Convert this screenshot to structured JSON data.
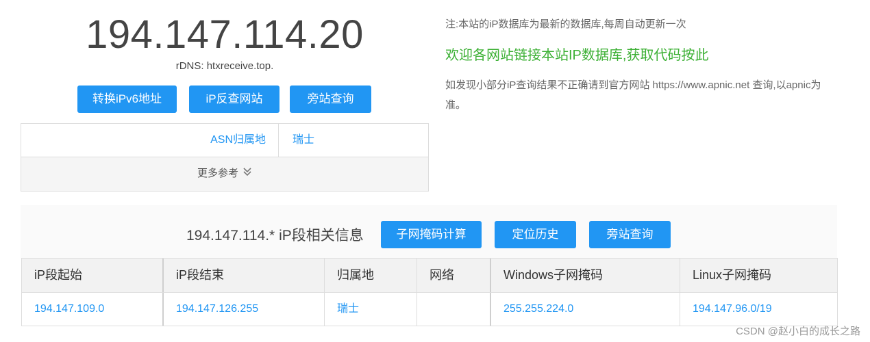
{
  "ip": {
    "address": "194.147.114.20",
    "rdns": "rDNS: htxreceive.top."
  },
  "actions": {
    "ipv6": "转换iPv6地址",
    "reverse": "iP反查网站",
    "sidesite": "旁站查询"
  },
  "info": {
    "asn_label": "ASN归属地",
    "asn_value": "瑞士",
    "more": "更多参考"
  },
  "notes": {
    "update": "注:本站的iP数据库为最新的数据库,每周自动更新一次",
    "welcome": "欢迎各网站链接本站IP数据库,获取代码按此",
    "correction": "如发现小部分iP查询结果不正确请到官方网站 https://www.apnic.net 查询,以apnic为准。"
  },
  "segment": {
    "title": "194.147.114.* iP段相关信息",
    "subnet_btn": "子网掩码计算",
    "history_btn": "定位历史",
    "side_btn": "旁站查询",
    "headers": [
      "iP段起始",
      "iP段结束",
      "归属地",
      "网络",
      "Windows子网掩码",
      "Linux子网掩码"
    ],
    "row": [
      "194.147.109.0",
      "194.147.126.255",
      "瑞士",
      "",
      "255.255.224.0",
      "194.147.96.0/19"
    ]
  },
  "watermark": "CSDN @赵小白的成长之路",
  "colors": {
    "accent": "#2196f3",
    "green": "#3cb034"
  }
}
